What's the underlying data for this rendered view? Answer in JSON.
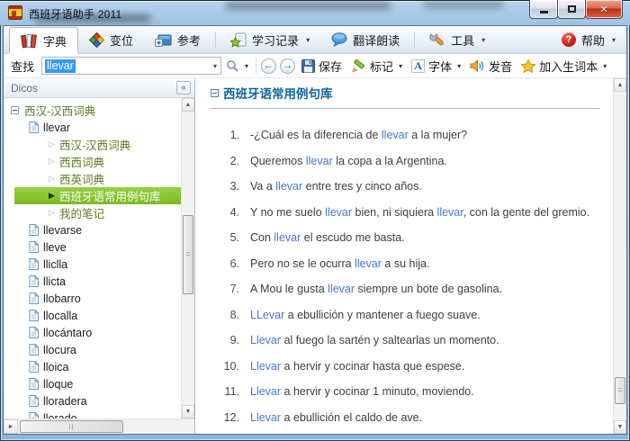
{
  "window": {
    "title": "西班牙语助手 2011"
  },
  "icons": {
    "dropdown_caret": "▾",
    "combo_caret": "▼",
    "back_arrow": "←",
    "forward_arrow": "→",
    "help_glyph": "?",
    "close_glyph": "✕",
    "collapse_sidebar": "«",
    "tree_collapsed": "▷",
    "tree_selected": "▶",
    "scroll_up": "▲",
    "scroll_down": "▼",
    "scroll_left": "◄",
    "scroll_right": "►",
    "font_letter": "A"
  },
  "colors": {
    "link_blue": "#4477d4",
    "header_blue": "#10649e",
    "tree_green": "#5c7a22",
    "selection_green": "#7cba22",
    "input_selection": "#3399ff",
    "close_red": "#bc3014"
  },
  "tabs": [
    {
      "label": "字典",
      "icon": "books-icon",
      "active": true,
      "dropdown": false,
      "sep_after": false
    },
    {
      "label": "变位",
      "icon": "cubes-icon",
      "active": false,
      "dropdown": false,
      "sep_after": false
    },
    {
      "label": "参考",
      "icon": "folder-icon",
      "active": false,
      "dropdown": false,
      "sep_after": true
    },
    {
      "label": "学习记录",
      "icon": "study-record-icon",
      "active": false,
      "dropdown": true,
      "sep_after": false
    },
    {
      "label": "翻译朗读",
      "icon": "speech-bubble-icon",
      "active": false,
      "dropdown": false,
      "sep_after": true
    },
    {
      "label": "工具",
      "icon": "wrench-icon",
      "active": false,
      "dropdown": true,
      "sep_after": false,
      "spacer_after": true
    },
    {
      "label": "帮助",
      "icon": "help-icon",
      "active": false,
      "dropdown": true,
      "sep_after": false
    }
  ],
  "search_bar": {
    "label": "查找",
    "input_value": "llevar",
    "buttons": [
      {
        "label": "保存",
        "icon": "save-icon",
        "dropdown": false
      },
      {
        "label": "标记",
        "icon": "marker-icon",
        "dropdown": true
      },
      {
        "label": "字体",
        "icon": "font-icon",
        "dropdown": true
      },
      {
        "label": "发音",
        "icon": "speaker-icon",
        "dropdown": false
      },
      {
        "label": "加入生词本",
        "icon": "star-icon",
        "dropdown": true
      }
    ]
  },
  "sidebar": {
    "header": "Dicos",
    "tree": [
      {
        "label": "西汉-汉西词典",
        "level": 0,
        "kind": "root",
        "selected": false
      },
      {
        "label": "llevar",
        "level": 1,
        "kind": "word",
        "selected": false
      },
      {
        "label": "西汉-汉西词典",
        "level": 2,
        "kind": "dict",
        "selected": false
      },
      {
        "label": "西西词典",
        "level": 2,
        "kind": "dict",
        "selected": false
      },
      {
        "label": "西英词典",
        "level": 2,
        "kind": "dict",
        "selected": false
      },
      {
        "label": "西班牙语常用例句库",
        "level": 2,
        "kind": "dict",
        "selected": true
      },
      {
        "label": "我的笔记",
        "level": 2,
        "kind": "dict",
        "selected": false
      },
      {
        "label": "llevarse",
        "level": 1,
        "kind": "word",
        "selected": false
      },
      {
        "label": "lleve",
        "level": 1,
        "kind": "word",
        "selected": false
      },
      {
        "label": "lliclla",
        "level": 1,
        "kind": "word",
        "selected": false
      },
      {
        "label": "llicta",
        "level": 1,
        "kind": "word",
        "selected": false
      },
      {
        "label": "llobarro",
        "level": 1,
        "kind": "word",
        "selected": false
      },
      {
        "label": "llocalla",
        "level": 1,
        "kind": "word",
        "selected": false
      },
      {
        "label": "llocántaro",
        "level": 1,
        "kind": "word",
        "selected": false
      },
      {
        "label": "llocura",
        "level": 1,
        "kind": "word",
        "selected": false
      },
      {
        "label": "lloica",
        "level": 1,
        "kind": "word",
        "selected": false
      },
      {
        "label": "lloque",
        "level": 1,
        "kind": "word",
        "selected": false
      },
      {
        "label": "lloradera",
        "level": 1,
        "kind": "word",
        "selected": false
      },
      {
        "label": "llorado",
        "level": 1,
        "kind": "word",
        "selected": false
      }
    ]
  },
  "content": {
    "header": "西班牙语常用例句库",
    "sentences": [
      {
        "num": "1.",
        "segments": [
          {
            "text": "-¿Cuál es la diferencia de ",
            "link": false
          },
          {
            "text": "llevar",
            "link": true
          },
          {
            "text": " a la mujer?",
            "link": false
          }
        ]
      },
      {
        "num": "2.",
        "segments": [
          {
            "text": "Queremos ",
            "link": false
          },
          {
            "text": "llevar",
            "link": true
          },
          {
            "text": " la copa a la Argentina.",
            "link": false
          }
        ]
      },
      {
        "num": "3.",
        "segments": [
          {
            "text": "Va a ",
            "link": false
          },
          {
            "text": "llevar",
            "link": true
          },
          {
            "text": " entre tres y cinco años.",
            "link": false
          }
        ]
      },
      {
        "num": "4.",
        "segments": [
          {
            "text": "Y no me suelo ",
            "link": false
          },
          {
            "text": "llevar",
            "link": true
          },
          {
            "text": " bien, ni siquiera ",
            "link": false
          },
          {
            "text": "llevar",
            "link": true
          },
          {
            "text": ", con la gente del gremio.",
            "link": false
          }
        ]
      },
      {
        "num": "5.",
        "segments": [
          {
            "text": "Con ",
            "link": false
          },
          {
            "text": "llevar",
            "link": true
          },
          {
            "text": " el escudo me basta.",
            "link": false
          }
        ]
      },
      {
        "num": "6.",
        "segments": [
          {
            "text": "Pero no se le ocurra ",
            "link": false
          },
          {
            "text": "llevar",
            "link": true
          },
          {
            "text": " a su hija.",
            "link": false
          }
        ]
      },
      {
        "num": "7.",
        "segments": [
          {
            "text": "A Mou le gusta ",
            "link": false
          },
          {
            "text": "llevar",
            "link": true
          },
          {
            "text": " siempre un bote de gasolina.",
            "link": false
          }
        ]
      },
      {
        "num": "8.",
        "segments": [
          {
            "text": "LLevar",
            "link": true
          },
          {
            "text": " a ebullición y mantener a fuego suave.",
            "link": false
          }
        ]
      },
      {
        "num": "9.",
        "segments": [
          {
            "text": "Llevar",
            "link": true
          },
          {
            "text": " al fuego la sartén y saltearlas un momento.",
            "link": false
          }
        ]
      },
      {
        "num": "10.",
        "segments": [
          {
            "text": "Llevar",
            "link": true
          },
          {
            "text": " a hervir y cocinar hasta que espese.",
            "link": false
          }
        ]
      },
      {
        "num": "11.",
        "segments": [
          {
            "text": "Llevar",
            "link": true
          },
          {
            "text": " a hervir y cocinar 1 minuto, moviendo.",
            "link": false
          }
        ]
      },
      {
        "num": "12.",
        "segments": [
          {
            "text": "Llevar",
            "link": true
          },
          {
            "text": " a ebullición el caldo de ave.",
            "link": false
          }
        ]
      }
    ]
  }
}
